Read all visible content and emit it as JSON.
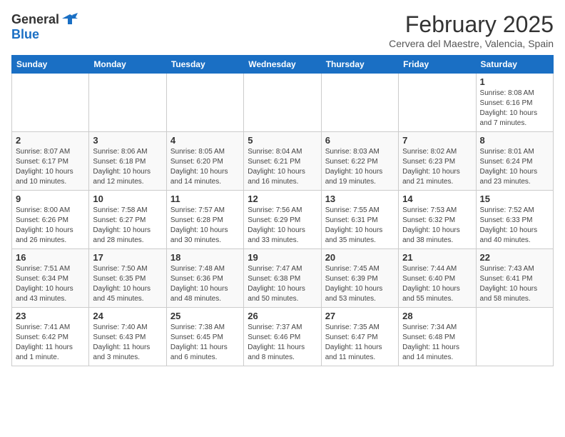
{
  "header": {
    "logo_general": "General",
    "logo_blue": "Blue",
    "month": "February 2025",
    "location": "Cervera del Maestre, Valencia, Spain"
  },
  "columns": [
    "Sunday",
    "Monday",
    "Tuesday",
    "Wednesday",
    "Thursday",
    "Friday",
    "Saturday"
  ],
  "weeks": [
    [
      {
        "day": "",
        "info": ""
      },
      {
        "day": "",
        "info": ""
      },
      {
        "day": "",
        "info": ""
      },
      {
        "day": "",
        "info": ""
      },
      {
        "day": "",
        "info": ""
      },
      {
        "day": "",
        "info": ""
      },
      {
        "day": "1",
        "info": "Sunrise: 8:08 AM\nSunset: 6:16 PM\nDaylight: 10 hours and 7 minutes."
      }
    ],
    [
      {
        "day": "2",
        "info": "Sunrise: 8:07 AM\nSunset: 6:17 PM\nDaylight: 10 hours and 10 minutes."
      },
      {
        "day": "3",
        "info": "Sunrise: 8:06 AM\nSunset: 6:18 PM\nDaylight: 10 hours and 12 minutes."
      },
      {
        "day": "4",
        "info": "Sunrise: 8:05 AM\nSunset: 6:20 PM\nDaylight: 10 hours and 14 minutes."
      },
      {
        "day": "5",
        "info": "Sunrise: 8:04 AM\nSunset: 6:21 PM\nDaylight: 10 hours and 16 minutes."
      },
      {
        "day": "6",
        "info": "Sunrise: 8:03 AM\nSunset: 6:22 PM\nDaylight: 10 hours and 19 minutes."
      },
      {
        "day": "7",
        "info": "Sunrise: 8:02 AM\nSunset: 6:23 PM\nDaylight: 10 hours and 21 minutes."
      },
      {
        "day": "8",
        "info": "Sunrise: 8:01 AM\nSunset: 6:24 PM\nDaylight: 10 hours and 23 minutes."
      }
    ],
    [
      {
        "day": "9",
        "info": "Sunrise: 8:00 AM\nSunset: 6:26 PM\nDaylight: 10 hours and 26 minutes."
      },
      {
        "day": "10",
        "info": "Sunrise: 7:58 AM\nSunset: 6:27 PM\nDaylight: 10 hours and 28 minutes."
      },
      {
        "day": "11",
        "info": "Sunrise: 7:57 AM\nSunset: 6:28 PM\nDaylight: 10 hours and 30 minutes."
      },
      {
        "day": "12",
        "info": "Sunrise: 7:56 AM\nSunset: 6:29 PM\nDaylight: 10 hours and 33 minutes."
      },
      {
        "day": "13",
        "info": "Sunrise: 7:55 AM\nSunset: 6:31 PM\nDaylight: 10 hours and 35 minutes."
      },
      {
        "day": "14",
        "info": "Sunrise: 7:53 AM\nSunset: 6:32 PM\nDaylight: 10 hours and 38 minutes."
      },
      {
        "day": "15",
        "info": "Sunrise: 7:52 AM\nSunset: 6:33 PM\nDaylight: 10 hours and 40 minutes."
      }
    ],
    [
      {
        "day": "16",
        "info": "Sunrise: 7:51 AM\nSunset: 6:34 PM\nDaylight: 10 hours and 43 minutes."
      },
      {
        "day": "17",
        "info": "Sunrise: 7:50 AM\nSunset: 6:35 PM\nDaylight: 10 hours and 45 minutes."
      },
      {
        "day": "18",
        "info": "Sunrise: 7:48 AM\nSunset: 6:36 PM\nDaylight: 10 hours and 48 minutes."
      },
      {
        "day": "19",
        "info": "Sunrise: 7:47 AM\nSunset: 6:38 PM\nDaylight: 10 hours and 50 minutes."
      },
      {
        "day": "20",
        "info": "Sunrise: 7:45 AM\nSunset: 6:39 PM\nDaylight: 10 hours and 53 minutes."
      },
      {
        "day": "21",
        "info": "Sunrise: 7:44 AM\nSunset: 6:40 PM\nDaylight: 10 hours and 55 minutes."
      },
      {
        "day": "22",
        "info": "Sunrise: 7:43 AM\nSunset: 6:41 PM\nDaylight: 10 hours and 58 minutes."
      }
    ],
    [
      {
        "day": "23",
        "info": "Sunrise: 7:41 AM\nSunset: 6:42 PM\nDaylight: 11 hours and 1 minute."
      },
      {
        "day": "24",
        "info": "Sunrise: 7:40 AM\nSunset: 6:43 PM\nDaylight: 11 hours and 3 minutes."
      },
      {
        "day": "25",
        "info": "Sunrise: 7:38 AM\nSunset: 6:45 PM\nDaylight: 11 hours and 6 minutes."
      },
      {
        "day": "26",
        "info": "Sunrise: 7:37 AM\nSunset: 6:46 PM\nDaylight: 11 hours and 8 minutes."
      },
      {
        "day": "27",
        "info": "Sunrise: 7:35 AM\nSunset: 6:47 PM\nDaylight: 11 hours and 11 minutes."
      },
      {
        "day": "28",
        "info": "Sunrise: 7:34 AM\nSunset: 6:48 PM\nDaylight: 11 hours and 14 minutes."
      },
      {
        "day": "",
        "info": ""
      }
    ]
  ]
}
